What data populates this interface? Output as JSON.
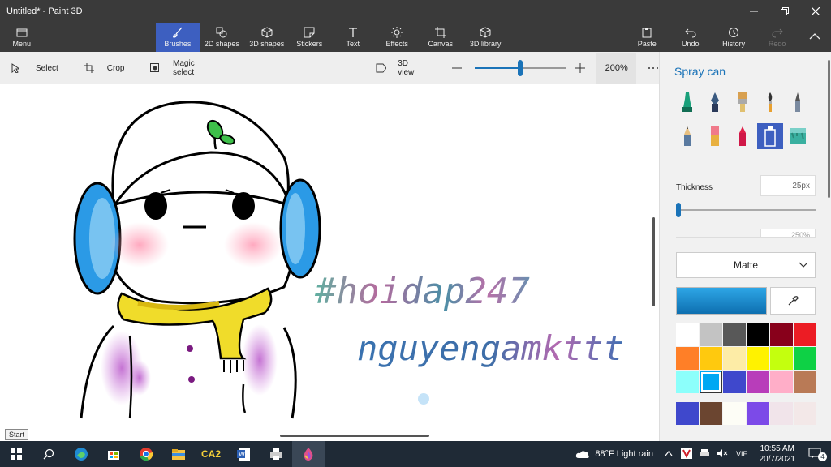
{
  "window": {
    "title": "Untitled* - Paint 3D"
  },
  "ribbon": {
    "menu": "Menu",
    "tools": [
      {
        "label": "Brushes",
        "icon": "brush-icon"
      },
      {
        "label": "2D shapes",
        "icon": "shapes-2d-icon"
      },
      {
        "label": "3D shapes",
        "icon": "shapes-3d-icon"
      },
      {
        "label": "Stickers",
        "icon": "sticker-icon"
      },
      {
        "label": "Text",
        "icon": "text-icon"
      },
      {
        "label": "Effects",
        "icon": "effects-icon"
      },
      {
        "label": "Canvas",
        "icon": "canvas-icon"
      },
      {
        "label": "3D library",
        "icon": "library-icon"
      }
    ],
    "paste": "Paste",
    "undo": "Undo",
    "history": "History",
    "redo": "Redo"
  },
  "subbar": {
    "select": "Select",
    "crop": "Crop",
    "magic_select": "Magic select",
    "view3d": "3D view",
    "zoom": "200%",
    "zoom_level": 0.5
  },
  "canvas": {
    "hashtag": "#hoidap247",
    "username": "nguyengamkttt"
  },
  "tooltip": "Start",
  "panel": {
    "title": "Spray can",
    "brushes": [
      "marker",
      "calligraphy-pen",
      "oil-brush",
      "watercolor",
      "pixel-pen",
      "pencil",
      "eraser",
      "crayon",
      "spray-can",
      "fill"
    ],
    "selected_brush": "spray-can",
    "thickness_label": "Thickness",
    "thickness_value": "25px",
    "opacity_value_partial": "250%",
    "finish": "Matte",
    "current_color": "#1e90d8",
    "palette": [
      "#ffffff",
      "#c3c3c3",
      "#585858",
      "#000000",
      "#88001b",
      "#ec1c24",
      "#ff7f27",
      "#ffc90e",
      "#fdeca6",
      "#fff200",
      "#c4ff0e",
      "#0ed145",
      "#8cfffb",
      "#00a8f3",
      "#3f48cc",
      "#b83dba",
      "#ffaec8",
      "#b97a56"
    ],
    "selected_swatch": 13,
    "custom_colors": [
      "#3f48cc",
      "#6b4530",
      "#fdfdf6",
      "#7c4ae8",
      "#f1e4ea",
      "#f3e8e8"
    ]
  },
  "taskbar": {
    "apps": [
      "windows-start",
      "search",
      "edge",
      "store",
      "chrome",
      "explorer",
      "ca2",
      "word",
      "printer",
      "paint3d"
    ],
    "ca2_label": "CA2",
    "weather": "88°F  Light rain",
    "lang": "VIE",
    "time": "10:55 AM",
    "date": "20/7/2021",
    "notifications": "4"
  }
}
